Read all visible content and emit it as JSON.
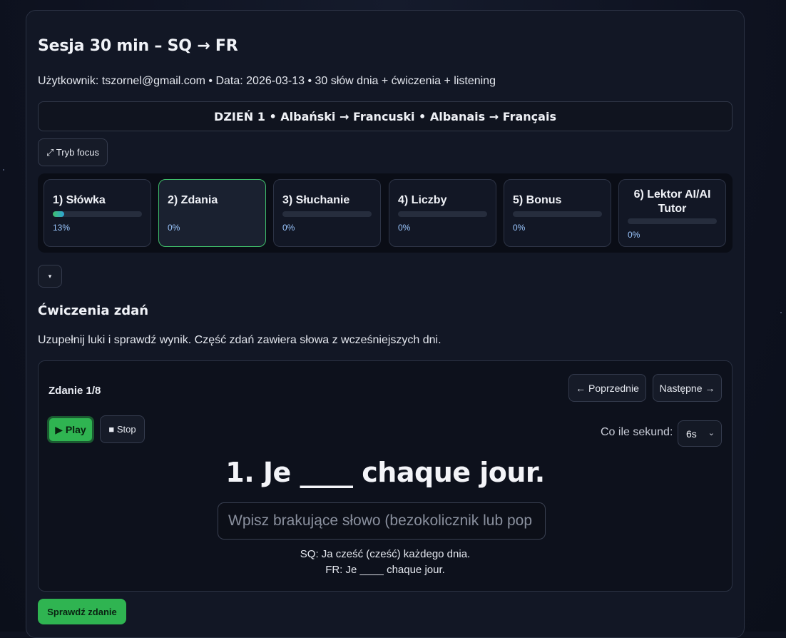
{
  "session": {
    "title": "Sesja 30 min – SQ → FR",
    "subtitle": "Użytkownik: tszornel@gmail.com • Data: 2026-03-13 • 30 słów dnia + ćwiczenia + listening"
  },
  "day_banner": "DZIEŃ 1 • Albański → Francuski • Albanais → Français",
  "focus_button": "⤢ Tryb focus",
  "steps": [
    {
      "label": "1) Słówka",
      "percent_text": "13%",
      "progress": 0.13
    },
    {
      "label": "2) Zdania",
      "percent_text": "0%",
      "progress": 0
    },
    {
      "label": "3) Słuchanie",
      "percent_text": "0%",
      "progress": 0
    },
    {
      "label": "4) Liczby",
      "percent_text": "0%",
      "progress": 0
    },
    {
      "label": "5) Bonus",
      "percent_text": "0%",
      "progress": 0
    },
    {
      "label": "6) Lektor AI/AI Tutor",
      "percent_text": "0%",
      "progress": 0
    }
  ],
  "active_step": 2,
  "collapse_button": "▾",
  "section": {
    "title": "Ćwiczenia zdań",
    "description": "Uzupełnij luki i sprawdź wynik. Część zdań zawiera słowa z wcześniejszych dni."
  },
  "exercise": {
    "counter": "Zdanie 1/8",
    "prev_label": "← Poprzednie",
    "next_label": "Następne →",
    "play_label": "▶ Play",
    "stop_label": "■ Stop",
    "interval_label": "Co ile sekund:",
    "interval_value": "6s",
    "interval_chevron": "⌄",
    "sentence": "1. Je ____ chaque jour.",
    "input_placeholder": "Wpisz brakujące słowo (bezokolicznik lub pop",
    "input_value": "",
    "hint_sq": "SQ: Ja cześć (cześć) każdego dnia.",
    "hint_fr": "FR: Je ____ chaque jour."
  },
  "check_button": "Sprawdź zdanie",
  "colors": {
    "accent_green": "#2fb451",
    "progress_blue": "#9bc7ff",
    "background": "#0f1320"
  }
}
